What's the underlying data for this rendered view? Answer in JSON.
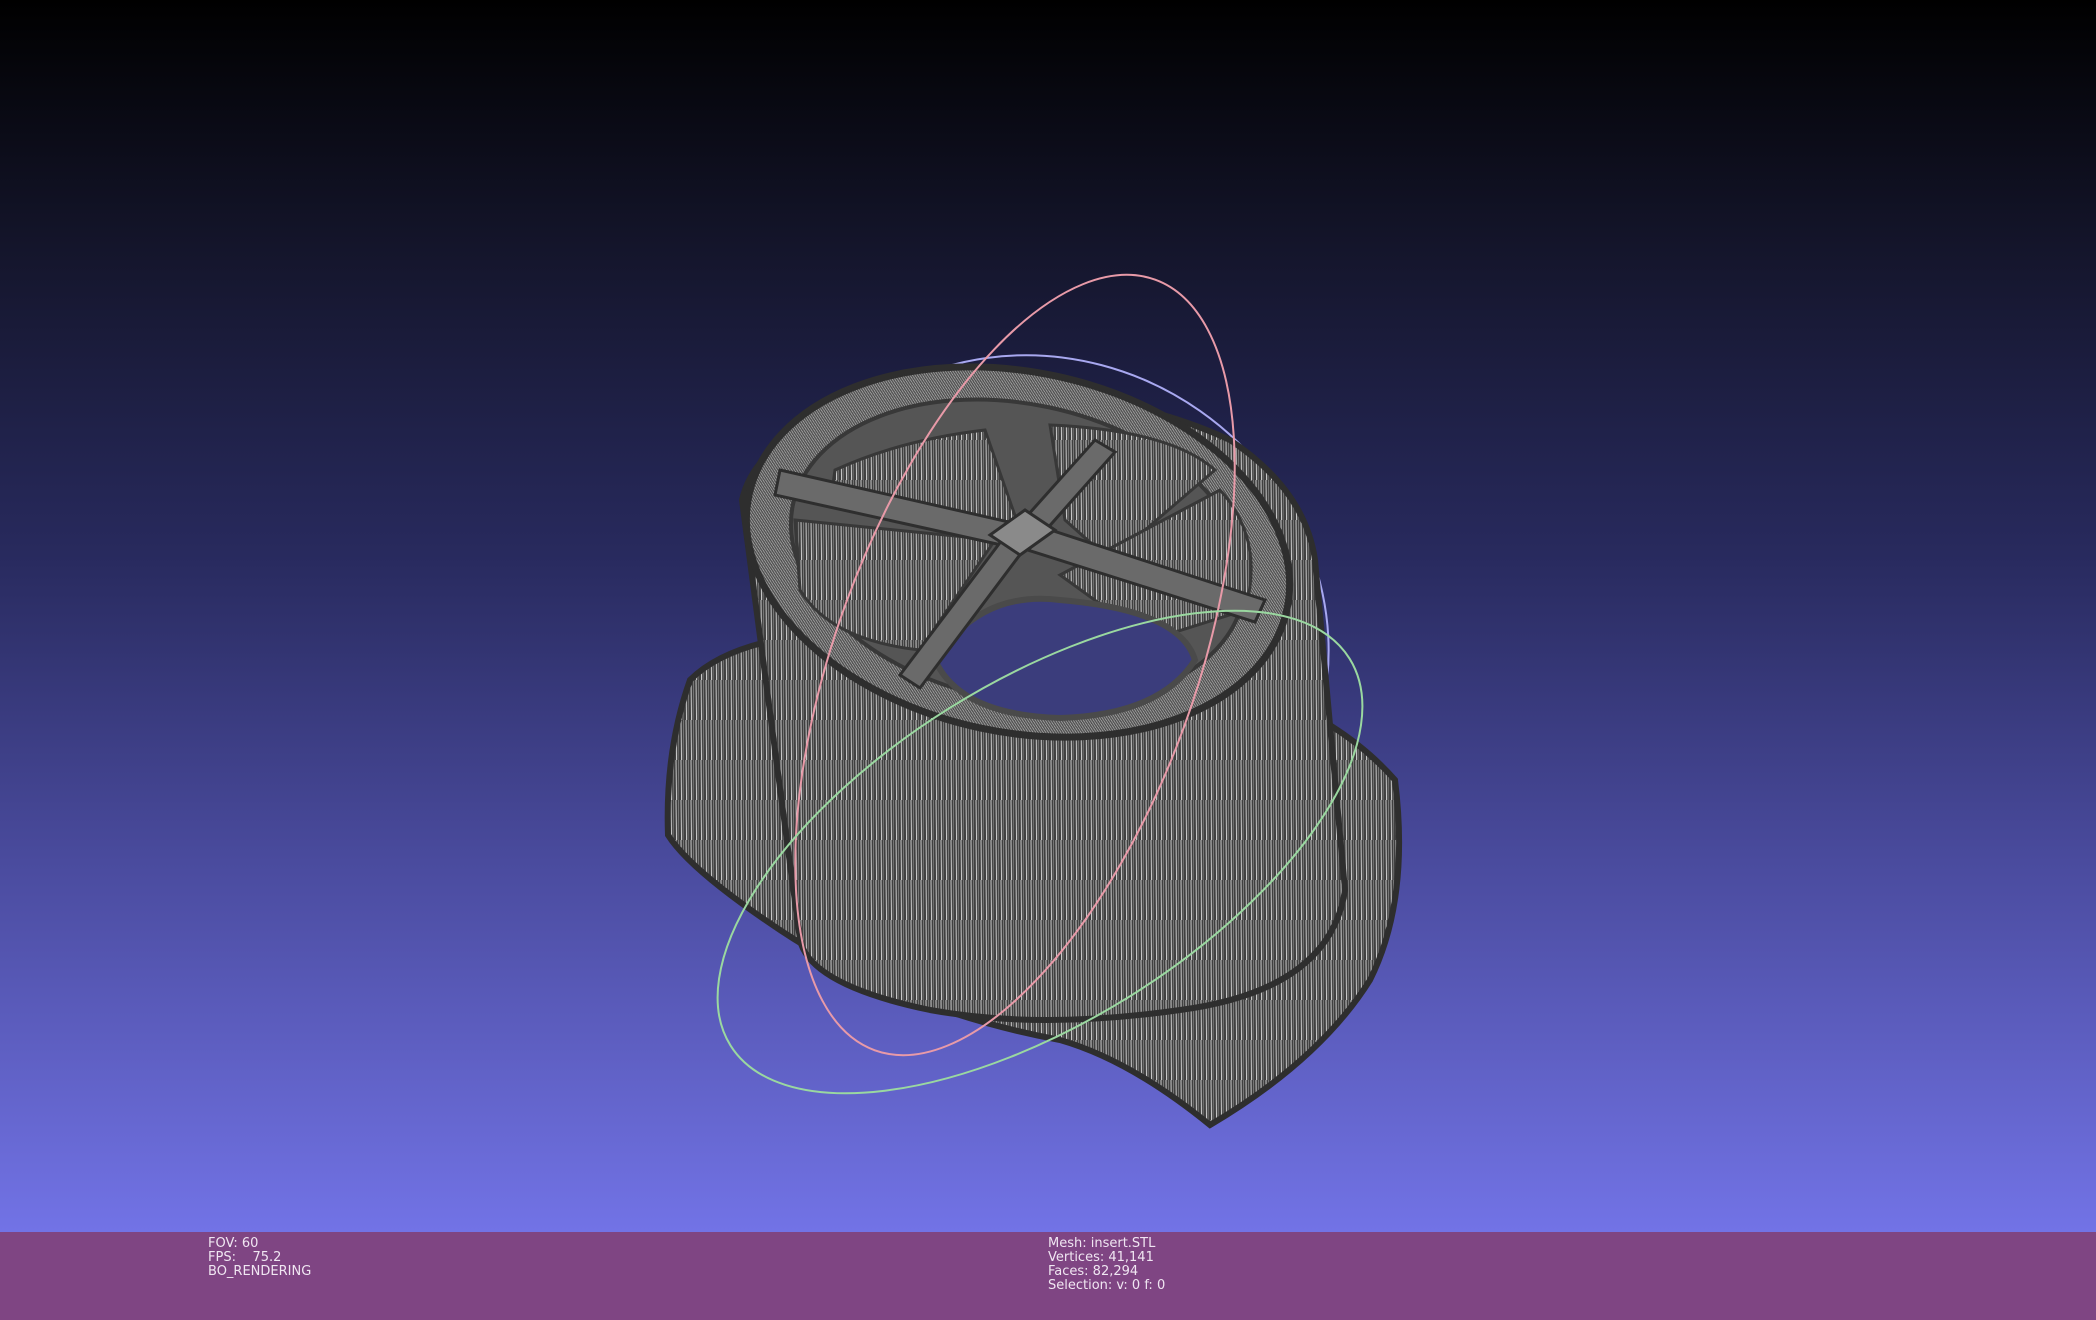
{
  "viewport": {
    "background_top": "#000000",
    "background_bottom": "#7273e6",
    "mesh_color": "#4a4a4a",
    "wire_color": "#d8d8d8",
    "trackball": {
      "x_axis_color": "#e89aa8",
      "y_axis_color": "#a8a8f0",
      "z_axis_color": "#9ad8a0"
    }
  },
  "status_bar": {
    "background": "#7f4583",
    "left": {
      "fov": "FOV: 60",
      "fps": "FPS:    75.2",
      "render_mode": "BO_RENDERING"
    },
    "right": {
      "mesh": "Mesh: insert.STL",
      "vertices": "Vertices: 41,141",
      "faces": "Faces: 82,294",
      "selection": "Selection: v: 0 f: 0"
    }
  }
}
